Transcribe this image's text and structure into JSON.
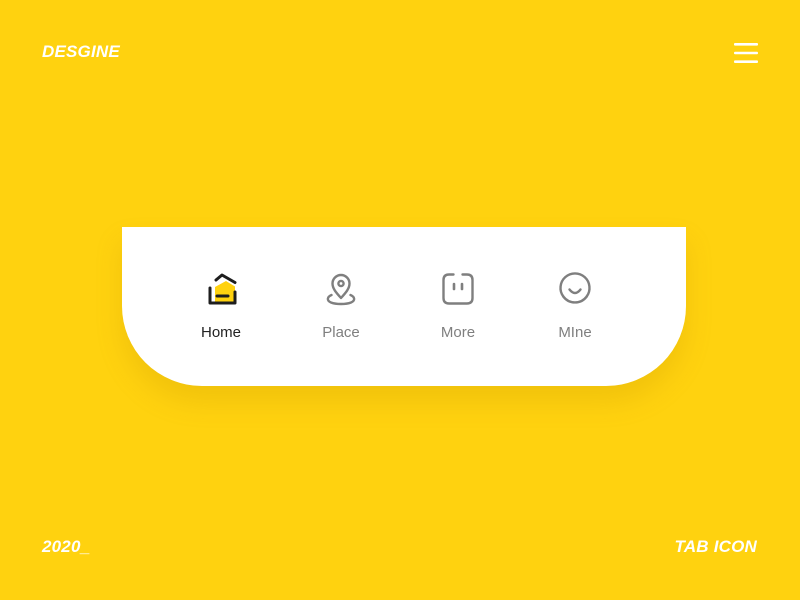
{
  "header": {
    "brand": "DESGINE",
    "menu_icon": "hamburger-menu-icon"
  },
  "footer": {
    "year": "2020_",
    "caption": "TAB ICON"
  },
  "tabbar": {
    "active_tab": "Home",
    "tabs": [
      {
        "label": "Home",
        "icon": "home-icon",
        "active": true
      },
      {
        "label": "Place",
        "icon": "location-pin-icon",
        "active": false
      },
      {
        "label": "More",
        "icon": "more-face-icon",
        "active": false
      },
      {
        "label": "MIne",
        "icon": "smile-icon",
        "active": false
      }
    ]
  },
  "colors": {
    "background": "#FFD20F",
    "card": "#FFFFFF",
    "accent": "#FFD20F",
    "active_icon_stroke": "#1E1E1E",
    "inactive": "#7F7F7F",
    "corner_text": "#FFFFFF"
  }
}
